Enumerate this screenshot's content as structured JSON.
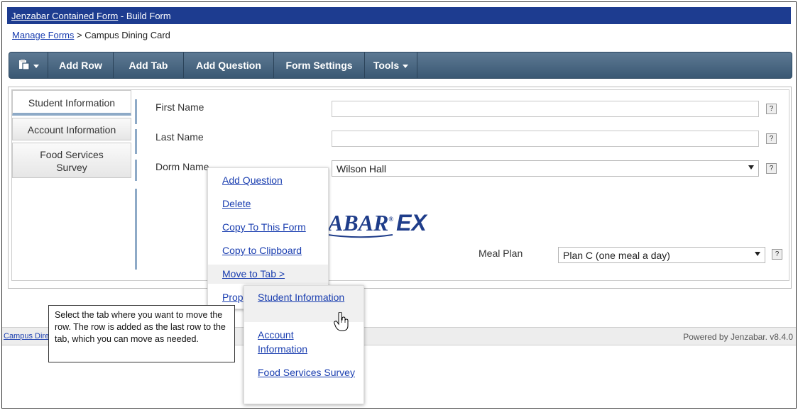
{
  "title": {
    "link": "Jenzabar Contained Form",
    "suffix": " - Build Form"
  },
  "breadcrumb": {
    "link": "Manage Forms",
    "separator": " > ",
    "current": "Campus Dining Card"
  },
  "toolbar": {
    "icon": "clipboard-icon",
    "buttons": [
      "Add Row",
      "Add Tab",
      "Add Question",
      "Form Settings",
      "Tools"
    ]
  },
  "tabs": [
    "Student Information",
    "Account Information",
    "Food Services Survey"
  ],
  "fields": {
    "first_name": "First Name",
    "last_name": "Last Name",
    "dorm_name": "Dorm Name",
    "dorm_value": "Wilson Hall",
    "meal_plan": "Meal Plan",
    "meal_value": "Plan C (one meal a day)",
    "help": "?"
  },
  "logo": {
    "text": "ABAR",
    "reg": "®",
    "suffix": "EX"
  },
  "context_menu": [
    "Add Question",
    "Delete",
    "Copy To This Form",
    "Copy to Clipboard",
    "Move to Tab >",
    "Prop"
  ],
  "submenu": [
    "Student Information",
    "Account Information",
    "Food Services Survey"
  ],
  "callout": "Select the tab where you want to move the row. The row is added as the last row to the tab, which you can move as needed.",
  "footer": {
    "left": "Campus Dire",
    "right": "Powered by Jenzabar. v8.4.0"
  },
  "colors": {
    "titlebar": "#1d3c90",
    "toolbar": "#4a6882",
    "link": "#1a3eb0",
    "tab_accent": "#8eaac7"
  }
}
